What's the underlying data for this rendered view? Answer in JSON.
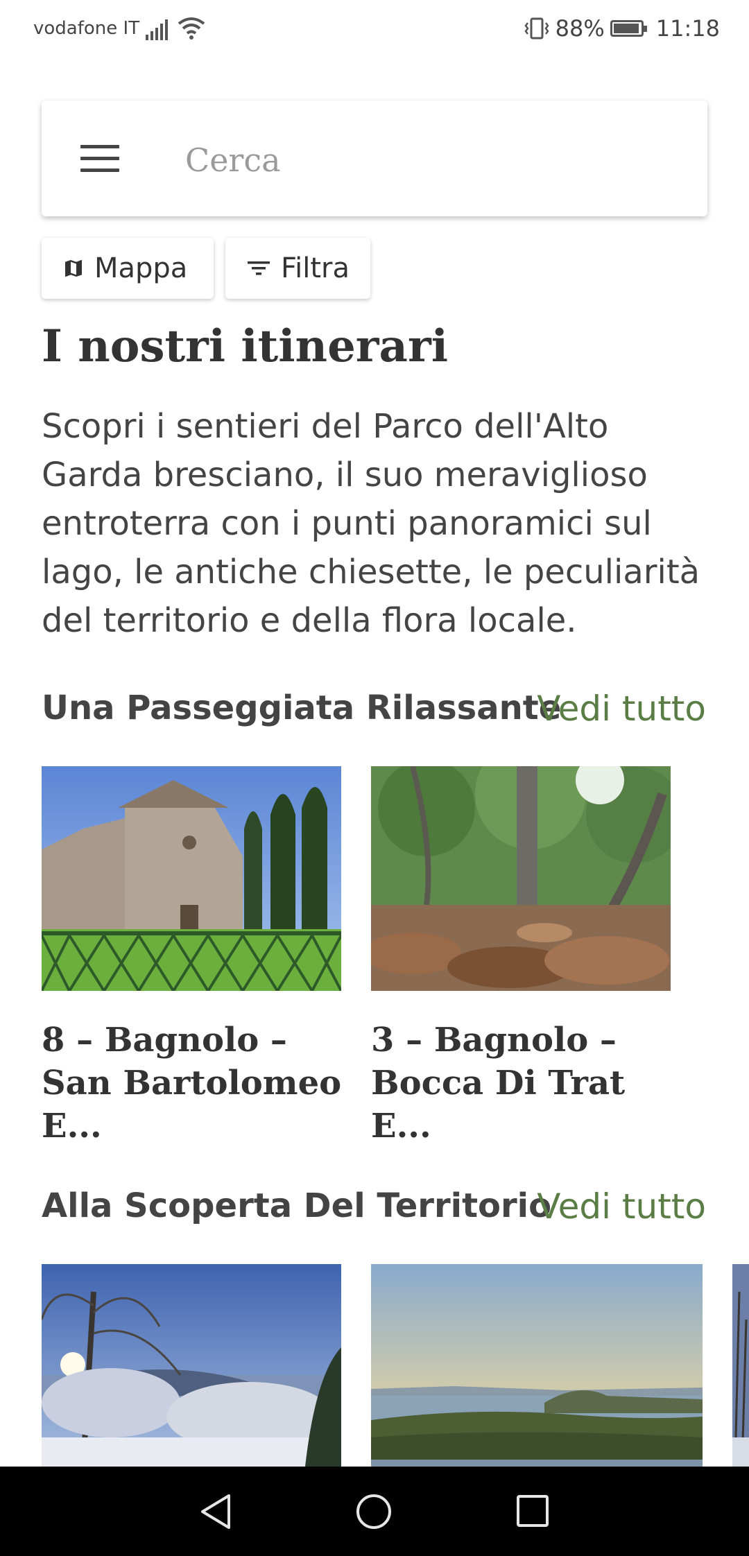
{
  "status": {
    "carrier": "vodafone IT",
    "battery": "88%",
    "time": "11:18"
  },
  "search": {
    "placeholder": "Cerca"
  },
  "chips": {
    "map_label": "Mappa",
    "filter_label": "Filtra"
  },
  "page": {
    "title": "I nostri itinerari",
    "intro": "Scopri i sentieri del Parco dell'Alto Garda bresciano, il suo meraviglioso entroterra con i punti panoramici sul lago, le antiche chiesette, le peculiarità del territorio e della flora locale."
  },
  "sections": [
    {
      "title": "Una Passeggiata Rilassante",
      "see_all": "Vedi tutto",
      "cards": [
        {
          "title": "8 – Bagnolo – San Bartolomeo E..."
        },
        {
          "title": "3 – Bagnolo – Bocca Di Trat E..."
        }
      ]
    },
    {
      "title": "Alla Scoperta Del Territorio",
      "see_all": "Vedi tutto"
    }
  ],
  "colors": {
    "accent": "#5a7d45",
    "nav_bar": "#000000"
  }
}
